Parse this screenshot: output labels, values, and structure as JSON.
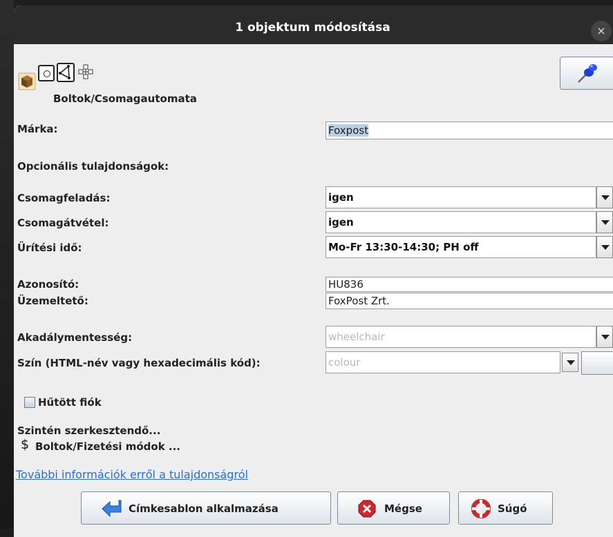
{
  "window": {
    "title": "1 objektum módosítása",
    "close_glyph": "×"
  },
  "preset": {
    "category": "Boltok/Csomagautomata",
    "icon": "package-icon",
    "type_icons": [
      "node-icon",
      "way-icon",
      "relation-icon"
    ],
    "pin_icon": "pushpin-icon"
  },
  "fields": {
    "brand": {
      "label": "Márka:",
      "value": "Foxpost"
    },
    "optional_heading": "Opcionális tulajdonságok:",
    "parcel_send": {
      "label": "Csomagfeladás:",
      "value": "igen"
    },
    "parcel_pickup": {
      "label": "Csomagátvétel:",
      "value": "igen"
    },
    "collection_times": {
      "label": "Ürítési idő:",
      "value": "Mo-Fr 13:30-14:30; PH off"
    },
    "ref": {
      "label": "Azonosító:",
      "value": "HU836"
    },
    "operator": {
      "label": "Üzemeltető:",
      "value": "FoxPost Zrt."
    },
    "wheelchair": {
      "label": "Akadálymentesség:",
      "value": "",
      "placeholder": "wheelchair"
    },
    "colour": {
      "label": "Szín (HTML-név vagy hexadecimális kód):",
      "value": "",
      "placeholder": "colour"
    },
    "refrigerated": {
      "label": "Hűtött fiók",
      "checked": false
    }
  },
  "also_edit": {
    "heading": "Szintén szerkesztendő...",
    "icon_glyph": "$",
    "link": "Boltok/Fizetési módok ..."
  },
  "info_link": "További információk erről a tulajdonságról",
  "buttons": {
    "apply": "Címkesablon alkalmazása",
    "cancel": "Mégse",
    "help": "Súgó"
  },
  "colors": {
    "link": "#2a6dd6",
    "selection": "#b8cfe5",
    "titlebar": "#2b2b2b"
  }
}
